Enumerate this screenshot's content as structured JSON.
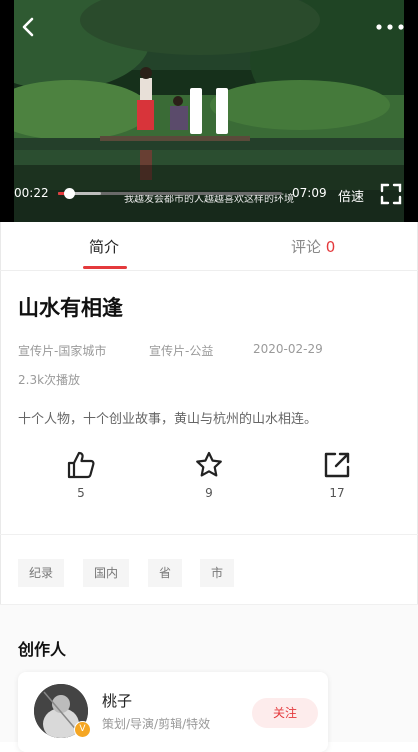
{
  "player": {
    "subtitle": "我越发会都市的人越越喜欢这样的环境",
    "current_time": "00:22",
    "duration": "07:09",
    "speed_label": "倍速",
    "progress_fraction": 0.05,
    "buffered_fraction": 0.19
  },
  "tabs": {
    "intro_label": "简介",
    "comment_label": "评论",
    "comment_count": "0"
  },
  "video": {
    "title": "山水有相逢",
    "category": "宣传片-国家城市",
    "subcategory": "宣传片-公益",
    "date": "2020-02-29",
    "plays": "2.3k次播放",
    "description": "十个人物，十个创业故事，黄山与杭州的山水相连。"
  },
  "actions": {
    "like_count": "5",
    "favorite_count": "9",
    "share_count": "17"
  },
  "tags": [
    "纪录",
    "国内",
    "省",
    "市"
  ],
  "creators": {
    "heading": "创作人",
    "name": "桃子",
    "role": "策划/导演/剪辑/特效",
    "follow_label": "关注",
    "verified_badge": "V"
  },
  "colors": {
    "accent": "#e4393c",
    "follow_bg": "#fdecec"
  }
}
